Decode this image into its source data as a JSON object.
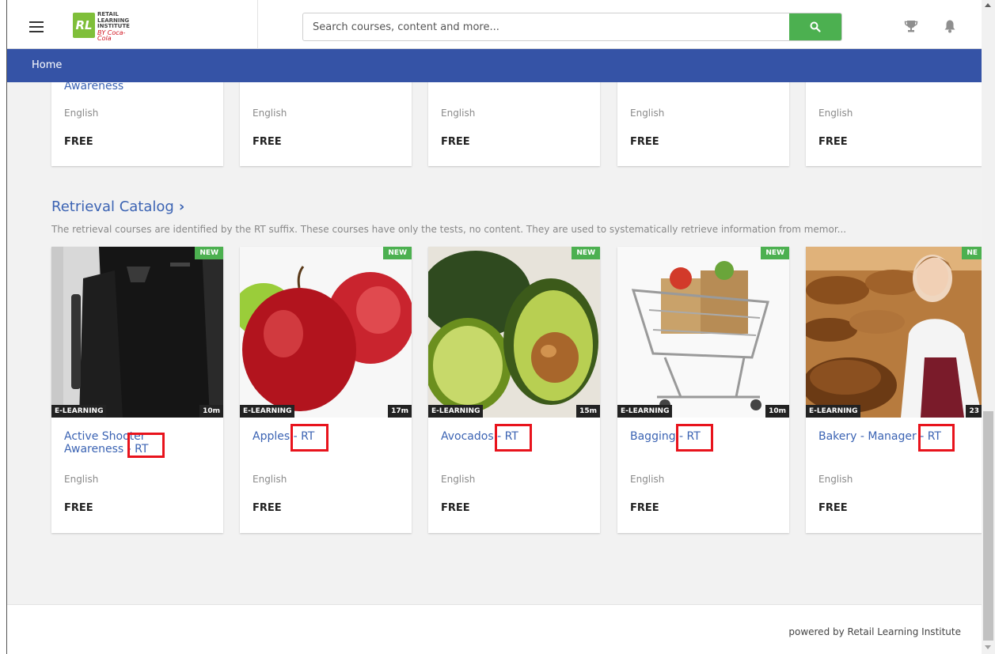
{
  "header": {
    "logo_lines": [
      "RETAIL",
      "LEARNING",
      "INSTITUTE",
      "BY Coca-Cola"
    ],
    "search_placeholder": "Search courses, content and more..."
  },
  "nav": {
    "home_label": "Home"
  },
  "top_row": {
    "first_title_fragment": "Awareness",
    "cards": [
      {
        "language": "English",
        "price": "FREE"
      },
      {
        "language": "English",
        "price": "FREE"
      },
      {
        "language": "English",
        "price": "FREE"
      },
      {
        "language": "English",
        "price": "FREE"
      },
      {
        "language": "English",
        "price": "FREE"
      }
    ]
  },
  "section": {
    "title": "Retrieval Catalog",
    "chevron": "›",
    "description": "The retrieval courses are identified by the RT suffix. These courses have only the tests, no content. They are used to systematically retrieve information from memor..."
  },
  "courses": [
    {
      "title": "Active Shooter Awareness - RT",
      "badge": "NEW",
      "type": "E-LEARNING",
      "duration": "10m",
      "language": "English",
      "price": "FREE"
    },
    {
      "title": "Apples - RT",
      "badge": "NEW",
      "type": "E-LEARNING",
      "duration": "17m",
      "language": "English",
      "price": "FREE"
    },
    {
      "title": "Avocados - RT",
      "badge": "NEW",
      "type": "E-LEARNING",
      "duration": "15m",
      "language": "English",
      "price": "FREE"
    },
    {
      "title": "Bagging - RT",
      "badge": "NEW",
      "type": "E-LEARNING",
      "duration": "10m",
      "language": "English",
      "price": "FREE"
    },
    {
      "title": "Bakery - Manager - RT",
      "badge": "NE",
      "type": "E-LEARNING",
      "duration": "23",
      "language": "English",
      "price": "FREE"
    }
  ],
  "footer": {
    "text": "powered by Retail Learning Institute"
  },
  "colors": {
    "nav_blue": "#3553a6",
    "link_blue": "#3b63b3",
    "green": "#4cb050",
    "highlight_red": "#e8131c"
  }
}
